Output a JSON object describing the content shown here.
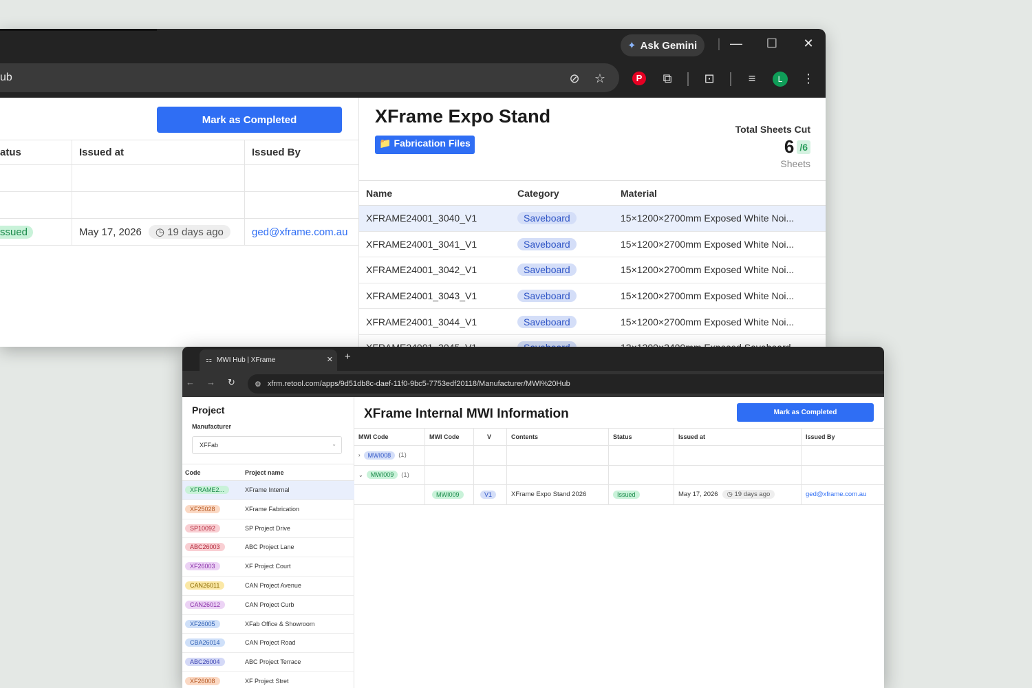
{
  "back_window": {
    "url_fragment": "ub",
    "gemini_label": "Ask Gemini",
    "avatar_initial": "L",
    "mark_completed": "Mark as Completed",
    "left_table": {
      "headers": [
        "atus",
        "Issued at",
        "Issued By"
      ],
      "row": {
        "status": "ssued",
        "issued_at": "May 17, 2026",
        "ago": "19 days ago",
        "issued_by": "ged@xframe.com.au"
      }
    },
    "title": "XFrame Expo Stand",
    "fabrication_button": "📁 Fabrication Files",
    "sheets": {
      "label": "Total Sheets Cut",
      "count": "6",
      "of": "/6",
      "unit": "Sheets"
    },
    "grid": {
      "headers": [
        "Name",
        "Category",
        "Material"
      ],
      "rows": [
        {
          "name": "XFRAME24001_3040_V1",
          "category": "Saveboard",
          "material": "15×1200×2700mm Exposed White Noi..."
        },
        {
          "name": "XFRAME24001_3041_V1",
          "category": "Saveboard",
          "material": "15×1200×2700mm Exposed White Noi..."
        },
        {
          "name": "XFRAME24001_3042_V1",
          "category": "Saveboard",
          "material": "15×1200×2700mm Exposed White Noi..."
        },
        {
          "name": "XFRAME24001_3043_V1",
          "category": "Saveboard",
          "material": "15×1200×2700mm Exposed White Noi..."
        },
        {
          "name": "XFRAME24001_3044_V1",
          "category": "Saveboard",
          "material": "15×1200×2700mm Exposed White Noi..."
        },
        {
          "name": "XFRAME24001_3045_V1",
          "category": "Saveboard",
          "material": "12×1200×2400mm Exposed Saveboard"
        }
      ]
    }
  },
  "front_window": {
    "tab_title": "MWI Hub | XFrame",
    "url": "xfrm.retool.com/apps/9d51db8c-daef-11f0-9bc5-7753edf20118/Manufacturer/MWI%20Hub",
    "sidebar": {
      "title": "Project",
      "manufacturer_label": "Manufacturer",
      "manufacturer_value": "XFFab",
      "headers": {
        "code": "Code",
        "name": "Project name"
      },
      "projects": [
        {
          "code": "XFRAME2...",
          "name": "XFrame Internal",
          "bg": "#c9f2d9",
          "fg": "#1a8a4a"
        },
        {
          "code": "XF25028",
          "name": "XFrame Fabrication",
          "bg": "#fbd9c4",
          "fg": "#b3541e"
        },
        {
          "code": "SP10092",
          "name": "SP Project Drive",
          "bg": "#f9cfd3",
          "fg": "#b3263a"
        },
        {
          "code": "ABC26003",
          "name": "ABC Project Lane",
          "bg": "#f9cfd3",
          "fg": "#b3263a"
        },
        {
          "code": "XF26003",
          "name": "XF Project Court",
          "bg": "#ecd3f5",
          "fg": "#8a2fa8"
        },
        {
          "code": "CAN26011",
          "name": "CAN Project Avenue",
          "bg": "#fbe8a6",
          "fg": "#8a6a00"
        },
        {
          "code": "CAN26012",
          "name": "CAN Project Curb",
          "bg": "#ecd3f5",
          "fg": "#8a2fa8"
        },
        {
          "code": "XF26005",
          "name": "XFab Office & Showroom",
          "bg": "#cfe0f9",
          "fg": "#2f5fb3"
        },
        {
          "code": "CBA26014",
          "name": "CAN Project Road",
          "bg": "#cfe0f9",
          "fg": "#2f5fb3"
        },
        {
          "code": "ABC26004",
          "name": "ABC Project Terrace",
          "bg": "#d4d9f7",
          "fg": "#3f46b3"
        },
        {
          "code": "XF26008",
          "name": "XF Project Stret",
          "bg": "#fbd9c4",
          "fg": "#b3541e"
        }
      ]
    },
    "main": {
      "title": "XFrame Internal MWI Information",
      "mark_completed": "Mark as Completed",
      "headers": [
        "MWI Code",
        "MWI Code",
        "V",
        "Contents",
        "Status",
        "Issued at",
        "Issued By"
      ],
      "groups": [
        {
          "caret": "›",
          "code": "MWI008",
          "count": "(1)"
        },
        {
          "caret": "⌄",
          "code": "MWI009",
          "count": "(1)"
        }
      ],
      "row": {
        "code": "MWI009",
        "version": "V1",
        "contents": "XFrame Expo Stand 2026",
        "status": "Issued",
        "issued_at": "May 17, 2026",
        "ago": "19 days ago",
        "issued_by": "ged@xframe.com.au"
      }
    }
  }
}
